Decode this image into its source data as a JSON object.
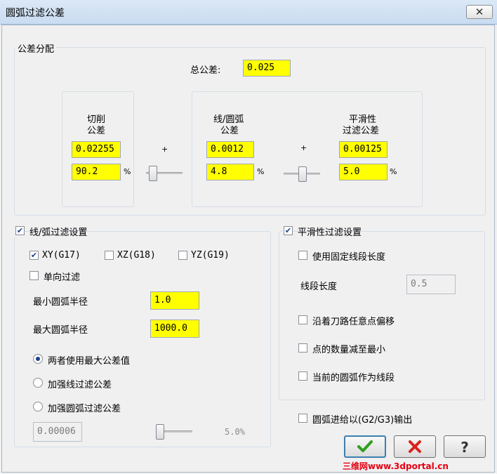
{
  "window": {
    "title": "圆弧过滤公差",
    "close_glyph": "✕"
  },
  "tolerance": {
    "group_label": "公差分配",
    "total_label": "总公差:",
    "total_value": "0.025",
    "plus_sign": "+",
    "percent_sign": "%",
    "cut": {
      "label_line1": "切削",
      "label_line2": "公差",
      "value": "0.02255",
      "percent": "90.2",
      "slider_fraction": 0.1
    },
    "linearc": {
      "label_line1": "线/圆弧",
      "label_line2": "公差",
      "value": "0.0012",
      "percent": "4.8",
      "slider_fraction": 0.52
    },
    "smooth": {
      "label_line1": "平滑性",
      "label_line2": "过滤公差",
      "value": "0.00125",
      "percent": "5.0"
    }
  },
  "linearc_filter": {
    "label": "线/弧过滤设置",
    "enabled": true,
    "plane_xy": {
      "label": "XY(G17)",
      "checked": true
    },
    "plane_xz": {
      "label": "XZ(G18)",
      "checked": false
    },
    "plane_yz": {
      "label": "YZ(G19)",
      "checked": false
    },
    "one_way": {
      "label": "单向过滤",
      "checked": false
    },
    "min_radius_label": "最小圆弧半径",
    "min_radius_value": "1.0",
    "max_radius_label": "最大圆弧半径",
    "max_radius_value": "1000.0",
    "radio_both": "两者使用最大公差值",
    "radio_line": "加强线过滤公差",
    "radio_arc": "加强圆弧过滤公差",
    "selected_radio": "both",
    "extra_tolerance_value": "0.00006",
    "extra_percent_text": "5.0%"
  },
  "smooth_filter": {
    "label": "平滑性过滤设置",
    "enabled": true,
    "fixed_segment": {
      "label": "使用固定线段长度",
      "checked": false
    },
    "segment_length_label": "线段长度",
    "segment_length_value": "0.5",
    "offset_along": {
      "label": "沿着刀路任意点偏移",
      "checked": false
    },
    "minimize_points": {
      "label": "点的数量减至最小",
      "checked": false
    },
    "arcs_as_lines": {
      "label": "当前的圆弧作为线段",
      "checked": false
    }
  },
  "arc_output": {
    "label": "圆弧进给以(G2/G3)输出",
    "checked": false
  },
  "buttons": {
    "ok_icon": "check-icon",
    "cancel_icon": "cross-icon",
    "help_icon": "question-icon",
    "help_glyph": "?"
  },
  "watermark": "三维网www.3dportal.cn",
  "colors": {
    "field_highlight": "#ffff00",
    "ok_green": "#2e9e1f",
    "cancel_red": "#d9231b",
    "check_blue": "#1b3f8a"
  }
}
